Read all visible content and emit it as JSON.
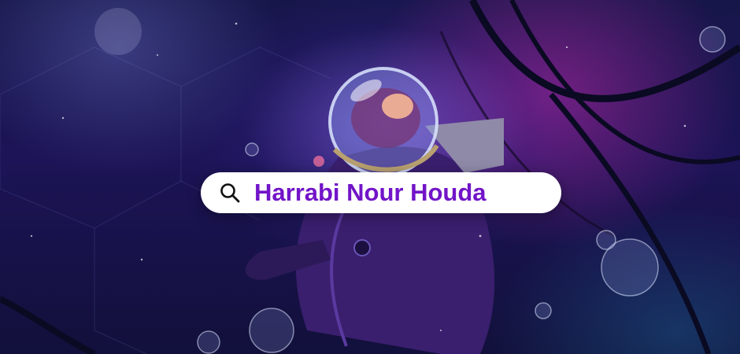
{
  "background": {
    "description_icon": "astronaut-space-scene",
    "colors": {
      "deep_navy": "#17164a",
      "violet_glow": "#9670ff",
      "magenta_glow": "#be28aa"
    }
  },
  "search": {
    "value": "Harrabi Nour Houda",
    "icon": "search-icon",
    "text_color": "#7214c8",
    "bar_color": "#ffffff"
  }
}
